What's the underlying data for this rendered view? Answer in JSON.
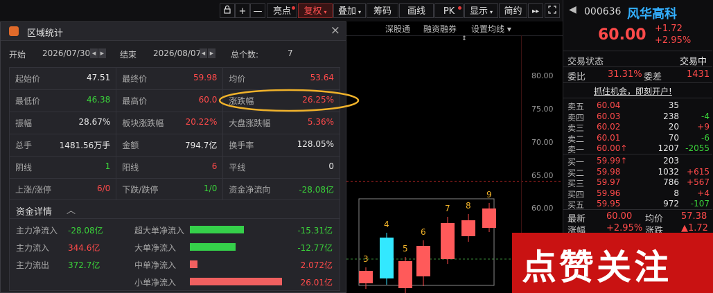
{
  "toolbar": {
    "lock_icon": "lock-icon",
    "plus": "+",
    "minus": "—",
    "buttons": [
      {
        "label": "亮点",
        "dot": true
      },
      {
        "label": "复权",
        "caret": true,
        "active": true
      },
      {
        "label": "叠加",
        "caret": true
      },
      {
        "label": "筹码"
      },
      {
        "label": "画线"
      },
      {
        "label": "PK",
        "dot": true
      },
      {
        "label": "显示",
        "caret": true
      },
      {
        "label": "简约"
      }
    ],
    "next": "▸▸",
    "expand_icon": "expand-icon"
  },
  "chart": {
    "tabs": [
      "深股通",
      "融资融券",
      "设置均线 ▾"
    ],
    "price_ticks": [
      "80.00",
      "75.00",
      "70.00",
      "65.00",
      "60.00"
    ],
    "candle_labels": [
      "3",
      "4",
      "5",
      "6",
      "7",
      "8",
      "9"
    ],
    "colors": {
      "up": "#ff4a4a",
      "down": "#33e0ff",
      "selection": "#888888"
    }
  },
  "panel": {
    "title": "区域统计",
    "start_label": "开始",
    "start_date": "2026/07/30",
    "end_label": "结束",
    "end_date": "2026/08/07",
    "count_label": "总个数:",
    "count_value": "7",
    "grid": [
      [
        {
          "l": "起始价",
          "v": "47.51",
          "c": "white"
        },
        {
          "l": "最终价",
          "v": "59.98",
          "c": "red"
        },
        {
          "l": "均价",
          "v": "53.64",
          "c": "red"
        }
      ],
      [
        {
          "l": "最低价",
          "v": "46.38",
          "c": "green"
        },
        {
          "l": "最高价",
          "v": "60.0",
          "c": "red"
        },
        {
          "l": "涨跌幅",
          "v": "26.25%",
          "c": "red"
        }
      ],
      [
        {
          "l": "振幅",
          "v": "28.67%",
          "c": "white"
        },
        {
          "l": "板块涨跌幅",
          "v": "20.22%",
          "c": "red"
        },
        {
          "l": "大盘涨跌幅",
          "v": "5.36%",
          "c": "red"
        }
      ],
      [
        {
          "l": "总手",
          "v": "1481.56万手",
          "c": "white"
        },
        {
          "l": "金额",
          "v": "794.7亿",
          "c": "white"
        },
        {
          "l": "换手率",
          "v": "128.05%",
          "c": "white"
        }
      ],
      [
        {
          "l": "阴线",
          "v": "1",
          "c": "green"
        },
        {
          "l": "阳线",
          "v": "6",
          "c": "red"
        },
        {
          "l": "平线",
          "v": "0",
          "c": "white"
        }
      ],
      [
        {
          "l": "上涨/涨停",
          "v": "6/0",
          "c": "red"
        },
        {
          "l": "下跌/跌停",
          "v": "1/0",
          "c": "green"
        },
        {
          "l": "资金净流向",
          "v": "-28.08亿",
          "c": "green"
        }
      ]
    ],
    "fund_title": "资金详情",
    "fund_left": [
      {
        "l": "主力净流入",
        "v": "-28.08亿",
        "c": "green"
      },
      {
        "l": "主力流入",
        "v": "344.6亿",
        "c": "red"
      },
      {
        "l": "主力流出",
        "v": "372.7亿",
        "c": "green"
      }
    ],
    "fund_right": [
      {
        "l": "超大单净流入",
        "v": "-15.31亿",
        "c": "green",
        "share": 0.49
      },
      {
        "l": "大单净流入",
        "v": "-12.77亿",
        "c": "green",
        "share": 0.41
      },
      {
        "l": "中单净流入",
        "v": "2.072亿",
        "c": "red",
        "share": 0.07
      },
      {
        "l": "小单净流入",
        "v": "26.01亿",
        "c": "red",
        "share": 0.83
      }
    ]
  },
  "quote": {
    "code": "000636",
    "name": "风华高科",
    "price": "60.00",
    "change": "+1.72",
    "change_pct": "+2.95%",
    "status_label": "交易状态",
    "status_value": "交易中",
    "wb_label": "委比",
    "wb_value": "31.31%",
    "wc_label": "委差",
    "wc_value": "1431",
    "promo": "抓住机会，即刻开户!",
    "asks": [
      {
        "l": "卖五",
        "p": "60.04",
        "v": "35",
        "d": ""
      },
      {
        "l": "卖四",
        "p": "60.03",
        "v": "238",
        "d": "-4"
      },
      {
        "l": "卖三",
        "p": "60.02",
        "v": "20",
        "d": "+9"
      },
      {
        "l": "卖二",
        "p": "60.01",
        "v": "70",
        "d": "-6"
      },
      {
        "l": "卖一",
        "p": "60.00↑",
        "v": "1207",
        "d": "-2055"
      }
    ],
    "bids": [
      {
        "l": "买一",
        "p": "59.99↑",
        "v": "203",
        "d": ""
      },
      {
        "l": "买二",
        "p": "59.98",
        "v": "1032",
        "d": "+615"
      },
      {
        "l": "买三",
        "p": "59.97",
        "v": "786",
        "d": "+567"
      },
      {
        "l": "买四",
        "p": "59.96",
        "v": "8",
        "d": "+4"
      },
      {
        "l": "买五",
        "p": "59.95",
        "v": "972",
        "d": "-107"
      }
    ],
    "latest_label": "最新",
    "latest_value": "60.00",
    "avg_label": "均价",
    "avg_value": "57.38",
    "zf_label": "涨幅",
    "zf_value": "+2.95%",
    "zd_label": "涨跌",
    "zd_value": "▲1.72"
  },
  "banner": "点赞关注"
}
